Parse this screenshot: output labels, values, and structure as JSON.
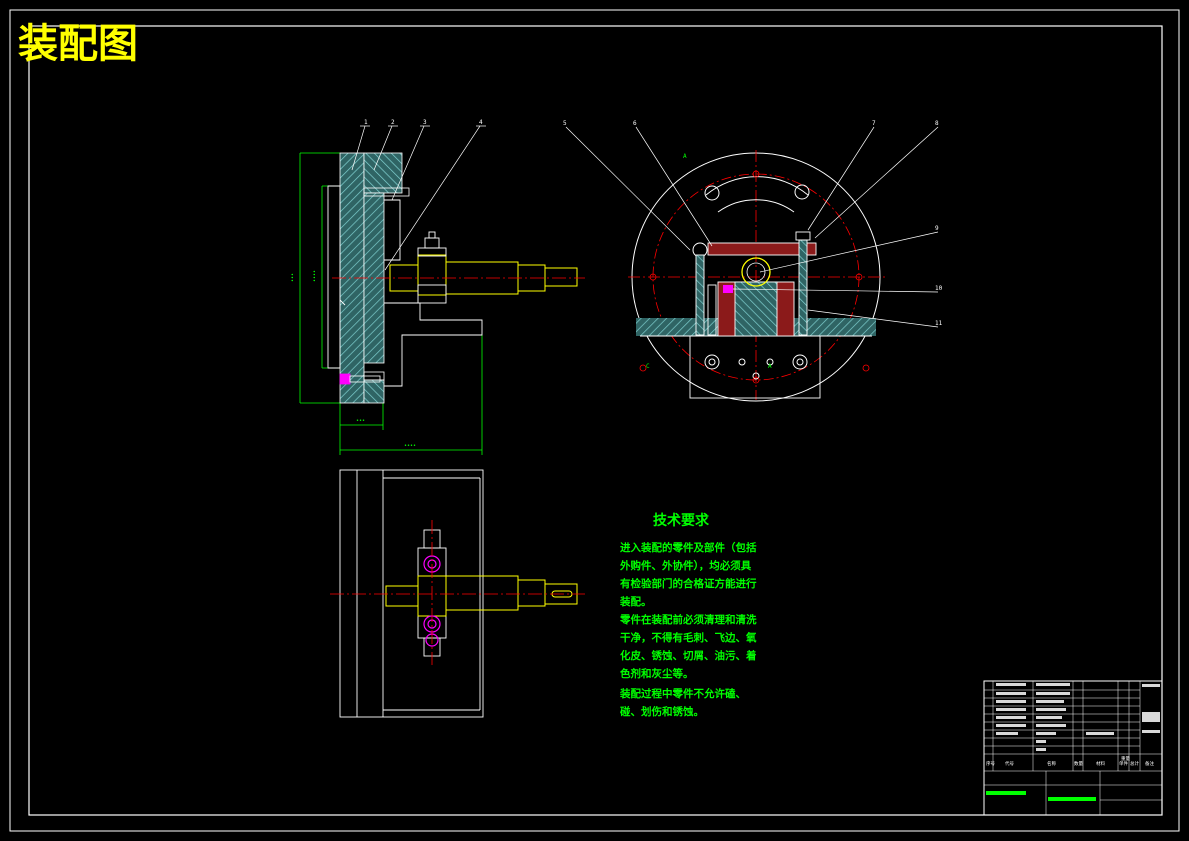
{
  "title": "装配图",
  "tech_requirements": {
    "heading": "技术要求",
    "lines": [
      "进入装配的零件及部件（包括",
      "外购件、外协件），均必须具",
      "有检验部门的合格证方能进行",
      "装配。",
      "零件在装配前必须清理和清洗",
      "干净，不得有毛刺、飞边、氧",
      "化皮、锈蚀、切屑、油污、着",
      "色剂和灰尘等。",
      "装配过程中零件不允许磕、",
      "碰、划伤和锈蚀。"
    ]
  },
  "balloons": {
    "left_view": [
      "1",
      "2",
      "3",
      "4"
    ],
    "right_view": [
      "5",
      "6",
      "7",
      "8",
      "9",
      "10",
      "11"
    ]
  },
  "title_block": {
    "col_headers": [
      "序号",
      "代号",
      "名称",
      "数量",
      "材料",
      "单件",
      "总计",
      "备注"
    ],
    "weight_label": "重量"
  },
  "colors": {
    "background": "#000000",
    "frame": "#ffffff",
    "title": "#ffff00",
    "requirements": "#00ff00",
    "dimension": "#00ff00",
    "centerline": "#ff0000",
    "part": "#ffff00",
    "bolt": "#ff00ff",
    "hatch": "#5fb3b3",
    "body_fill": "#8b1a1a"
  }
}
